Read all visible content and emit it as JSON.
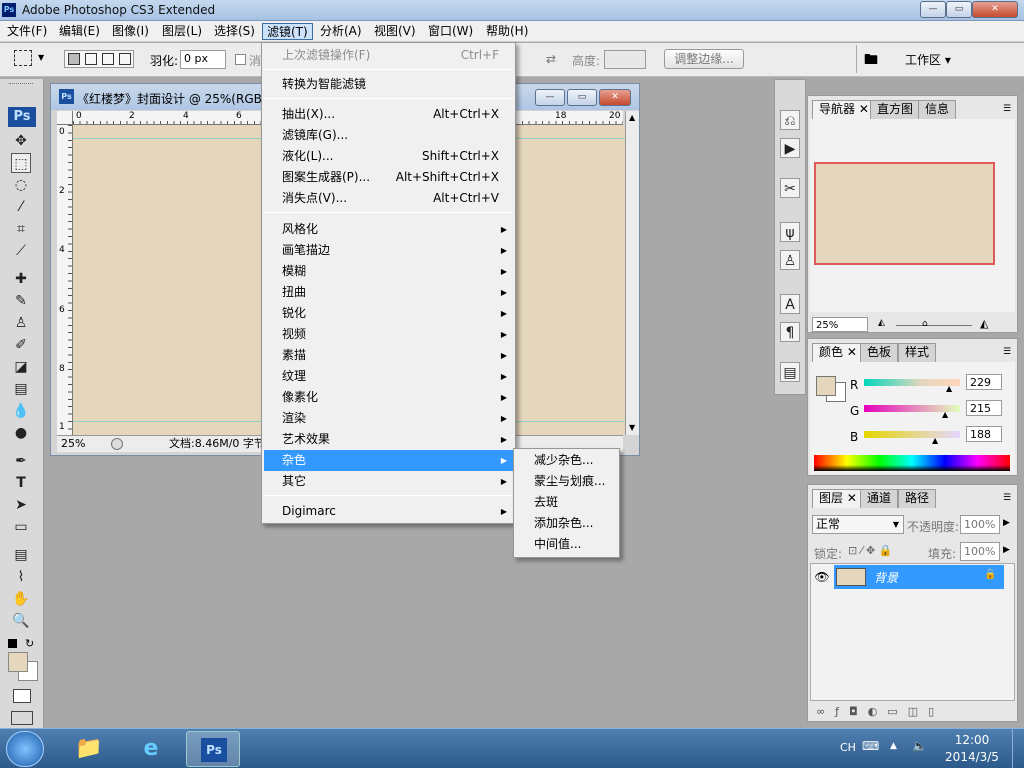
{
  "window": {
    "app_icon_text": "Ps",
    "title": "Adobe Photoshop CS3 Extended",
    "min": "—",
    "max": "▭",
    "close": "✕"
  },
  "menubar": [
    "文件(F)",
    "编辑(E)",
    "图像(I)",
    "图层(L)",
    "选择(S)",
    "滤镜(T)",
    "分析(A)",
    "视图(V)",
    "窗口(W)",
    "帮助(H)"
  ],
  "options": {
    "feather_label": "羽化:",
    "feather_value": "0 px",
    "antialias_label": "消",
    "height_label": "高度:",
    "refine_button": "调整边缘...",
    "workspace_label": "工作区 ▾"
  },
  "toolbar": {
    "ps_logo": "Ps"
  },
  "document": {
    "title": "《红楼梦》封面设计 @ 25%(RGB",
    "zoom": "25%",
    "status": "文档:8.46M/0 字节",
    "ruler_h": [
      "0",
      "2",
      "4",
      "6",
      "18",
      "20"
    ],
    "ruler_v": [
      "0",
      "2",
      "4",
      "6",
      "8",
      "1"
    ],
    "canvas_color": "#e5d7bc"
  },
  "filter_menu": {
    "items": [
      {
        "label": "上次滤镜操作(F)",
        "shortcut": "Ctrl+F",
        "disabled": true
      },
      {
        "label": "转换为智能滤镜"
      },
      {
        "label": "抽出(X)...",
        "shortcut": "Alt+Ctrl+X"
      },
      {
        "label": "滤镜库(G)..."
      },
      {
        "label": "液化(L)...",
        "shortcut": "Shift+Ctrl+X"
      },
      {
        "label": "图案生成器(P)...",
        "shortcut": "Alt+Shift+Ctrl+X"
      },
      {
        "label": "消失点(V)...",
        "shortcut": "Alt+Ctrl+V"
      },
      {
        "label": "风格化",
        "submenu": true
      },
      {
        "label": "画笔描边",
        "submenu": true
      },
      {
        "label": "模糊",
        "submenu": true
      },
      {
        "label": "扭曲",
        "submenu": true
      },
      {
        "label": "锐化",
        "submenu": true
      },
      {
        "label": "视频",
        "submenu": true
      },
      {
        "label": "素描",
        "submenu": true
      },
      {
        "label": "纹理",
        "submenu": true
      },
      {
        "label": "像素化",
        "submenu": true
      },
      {
        "label": "渲染",
        "submenu": true
      },
      {
        "label": "艺术效果",
        "submenu": true
      },
      {
        "label": "杂色",
        "submenu": true,
        "highlighted": true
      },
      {
        "label": "其它",
        "submenu": true
      },
      {
        "label": "Digimarc",
        "submenu": true
      }
    ]
  },
  "noise_submenu": [
    "减少杂色...",
    "蒙尘与划痕...",
    "去斑",
    "添加杂色...",
    "中间值..."
  ],
  "navigator": {
    "tabs": [
      "导航器",
      "直方图",
      "信息"
    ],
    "zoom": "25%"
  },
  "color_panel": {
    "tabs": [
      "颜色",
      "色板",
      "样式"
    ],
    "channels": [
      {
        "name": "R",
        "value": "229"
      },
      {
        "name": "G",
        "value": "215"
      },
      {
        "name": "B",
        "value": "188"
      }
    ],
    "swatch": "#e5d7bc"
  },
  "layers_panel": {
    "tabs": [
      "图层",
      "通道",
      "路径"
    ],
    "blend_mode": "正常",
    "opacity_label": "不透明度:",
    "opacity": "100%",
    "lock_label": "锁定:",
    "fill_label": "填充:",
    "fill": "100%",
    "layer_name": "背景"
  },
  "taskbar": {
    "lang": "CH",
    "time": "12:00",
    "date": "2014/3/5",
    "ps_label": "Ps"
  }
}
